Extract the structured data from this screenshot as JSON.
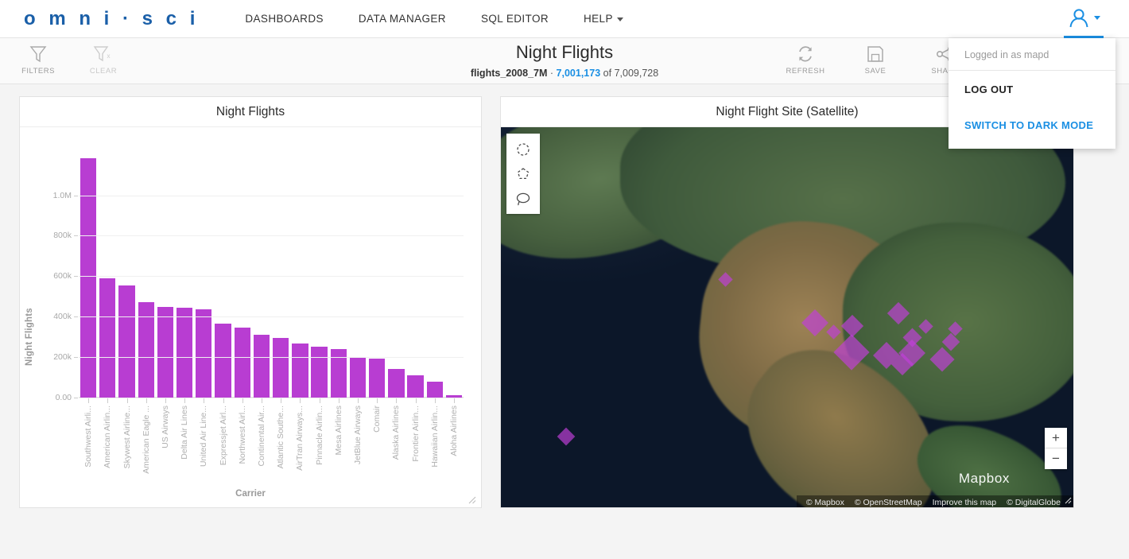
{
  "nav": {
    "logo": "o m n i · s c i",
    "links": [
      {
        "label": "DASHBOARDS",
        "icon": ""
      },
      {
        "label": "DATA MANAGER",
        "icon": ""
      },
      {
        "label": "SQL EDITOR",
        "icon": ""
      },
      {
        "label": "HELP",
        "icon": "chevron-down-icon"
      }
    ],
    "avatar_icon": "user-avatar-icon"
  },
  "user_menu": {
    "logged_in_as": "Logged in as mapd",
    "log_out": "LOG OUT",
    "switch_theme": "SWITCH TO DARK MODE"
  },
  "toolbar": {
    "filters_label": "FILTERS",
    "filters_icon": "funnel-icon",
    "clear_label": "CLEAR",
    "clear_icon": "funnel-clear-icon",
    "refresh_label": "REFRESH",
    "refresh_icon": "refresh-icon",
    "save_label": "SAVE",
    "save_icon": "floppy-disk-icon",
    "share_label": "SHARE",
    "share_icon": "share-nodes-icon"
  },
  "header": {
    "title": "Night Flights",
    "dataset": "flights_2008_7M",
    "separator": "·",
    "filtered_count": "7,001,173",
    "of_text": "of",
    "total_count": "7,009,728"
  },
  "chart_panel": {
    "title": "Night Flights"
  },
  "map_panel": {
    "title": "Night Flight Site (Satellite)",
    "tools": [
      {
        "name": "circle-select-tool",
        "icon": "dashed-circle-icon"
      },
      {
        "name": "polygon-select-tool",
        "icon": "dashed-polygon-icon"
      },
      {
        "name": "lasso-select-tool",
        "icon": "lasso-icon"
      }
    ],
    "zoom_in": "+",
    "zoom_out": "−",
    "watermark": "Mapbox",
    "attribution": [
      "© Mapbox",
      "© OpenStreetMap",
      "Improve this map",
      "© DigitalGlobe"
    ]
  },
  "colors": {
    "brand_blue": "#1a5fa8",
    "accent_blue": "#1a8fe3",
    "bar_magenta": "#b83dd2",
    "marker_magenta": "#c13fd8"
  },
  "chart_data": {
    "type": "bar",
    "title": "Night Flights",
    "xlabel": "Carrier",
    "ylabel": "Night Flights",
    "ylim": [
      0,
      1250000
    ],
    "grid": true,
    "legend": "none",
    "ytick_labels": [
      "0.00",
      "200k",
      "400k",
      "600k",
      "800k",
      "1.0M"
    ],
    "ytick_values": [
      0,
      200000,
      400000,
      600000,
      800000,
      1000000
    ],
    "categories": [
      "Southwest Airli...",
      "American Airlin...",
      "Skywest Airline...",
      "American Eagle ...",
      "US Airways",
      "Delta Air Lines",
      "United Air Line...",
      "Expressjet Airl...",
      "Northwest Airl...",
      "Continental Air...",
      "Atlantic Southe...",
      "AirTran Airways...",
      "Pinnacle Airlin...",
      "Mesa Airlines",
      "JetBlue Airways",
      "Comair",
      "Alaska Airlines",
      "Frontier Airlin...",
      "Hawaiian Airlin...",
      "Aloha Airlines"
    ],
    "values": [
      1185000,
      588000,
      553000,
      470000,
      450000,
      443000,
      437000,
      367000,
      345000,
      310000,
      295000,
      268000,
      250000,
      240000,
      198000,
      192000,
      140000,
      110000,
      78000,
      10000
    ]
  }
}
